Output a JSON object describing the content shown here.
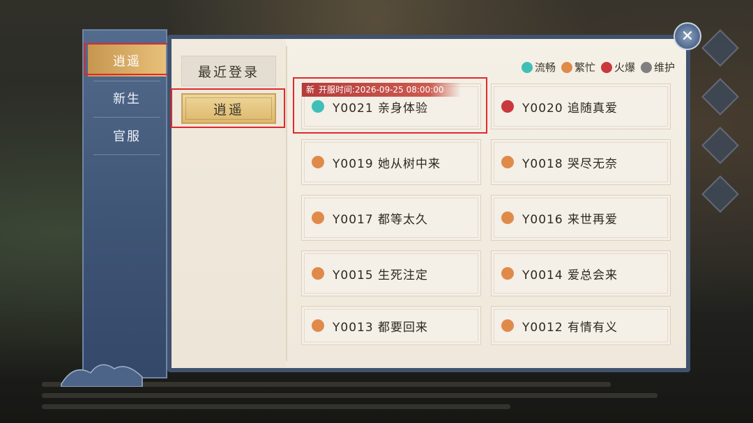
{
  "sidebar": {
    "items": [
      {
        "label": "逍遥",
        "active": true
      },
      {
        "label": "新生",
        "active": false
      },
      {
        "label": "官服",
        "active": false
      }
    ]
  },
  "tabs": {
    "recent": "最近登录",
    "current": "逍遥"
  },
  "legend": [
    {
      "label": "流畅",
      "color": "#3fbfb8"
    },
    {
      "label": "繁忙",
      "color": "#e08a4a"
    },
    {
      "label": "火爆",
      "color": "#c9383c"
    },
    {
      "label": "维护",
      "color": "#7f7f7f"
    }
  ],
  "new_ribbon": {
    "tag": "新",
    "text": "开服时间:2026-09-25 08:00:00"
  },
  "servers": [
    {
      "name": "Y0021 亲身体验",
      "status": "流畅",
      "color": "#3fbfb8",
      "new": true
    },
    {
      "name": "Y0020 追随真爱",
      "status": "火爆",
      "color": "#c9383c"
    },
    {
      "name": "Y0019 她从树中来",
      "status": "繁忙",
      "color": "#e08a4a"
    },
    {
      "name": "Y0018 哭尽无奈",
      "status": "繁忙",
      "color": "#e08a4a"
    },
    {
      "name": "Y0017 都等太久",
      "status": "繁忙",
      "color": "#e08a4a"
    },
    {
      "name": "Y0016 来世再爱",
      "status": "繁忙",
      "color": "#e08a4a"
    },
    {
      "name": "Y0015 生死注定",
      "status": "繁忙",
      "color": "#e08a4a"
    },
    {
      "name": "Y0014 爱总会来",
      "status": "繁忙",
      "color": "#e08a4a"
    },
    {
      "name": "Y0013 都要回来",
      "status": "繁忙",
      "color": "#e08a4a"
    },
    {
      "name": "Y0012 有情有义",
      "status": "繁忙",
      "color": "#e08a4a"
    }
  ],
  "close_icon": "close-icon"
}
